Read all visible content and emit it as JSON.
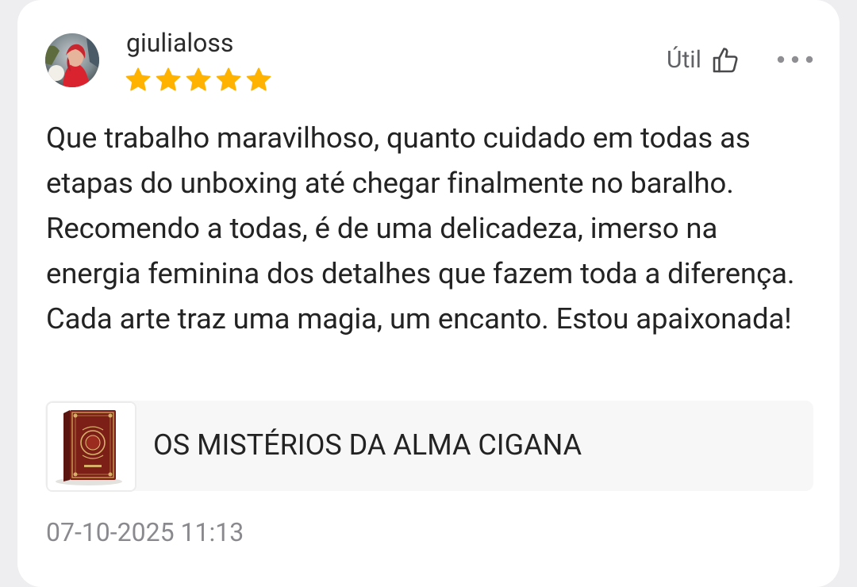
{
  "review": {
    "username": "giulialoss",
    "rating": 5,
    "rating_max": 5,
    "helpful_label": "Útil",
    "text": "Que trabalho maravilhoso, quanto cuidado em todas as etapas do unboxing até chegar finalmente no baralho. Recomendo a todas, é de uma delicadeza, imerso na energia feminina dos detalhes que fazem toda a diferença. Cada arte traz uma magia, um encanto. Estou apaixonada!",
    "timestamp": "07-10-2025 11:13"
  },
  "product": {
    "name": "OS MISTÉRIOS DA ALMA CIGANA"
  },
  "icons": {
    "star": "star-icon",
    "helpful": "thumbs-up-outline-icon",
    "more": "more-horizontal-dots-icon"
  },
  "colors": {
    "star": "#FFB300",
    "text": "#232323",
    "muted": "#8A8A8E",
    "card_background": "#FFFFFF",
    "page_background": "#EEEEF0",
    "product_card_background": "#F7F7F7"
  }
}
